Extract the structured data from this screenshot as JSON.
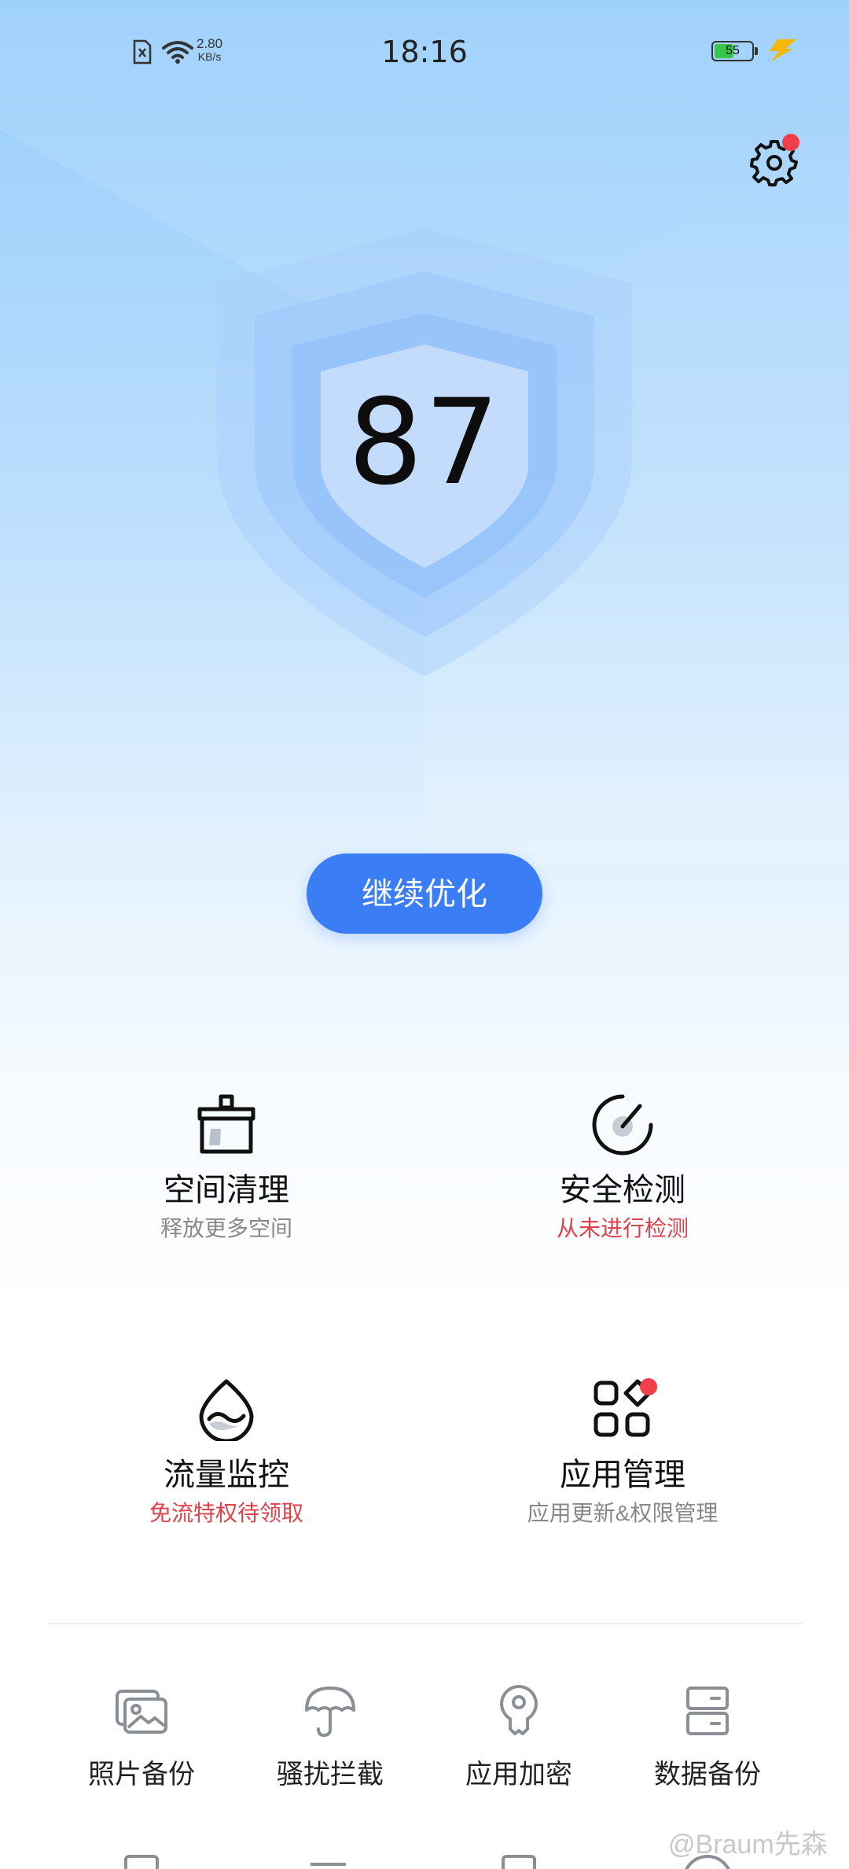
{
  "status_bar": {
    "time": "18:16",
    "net_speed_value": "2.80",
    "net_speed_unit": "KB/s",
    "battery_level": "55",
    "icons": [
      "no-sim-icon",
      "wifi-icon",
      "battery-icon",
      "charging-icon"
    ],
    "battery_fill_color": "#36c64a",
    "charging_color": "#f5b800"
  },
  "header": {
    "settings_icon": "gear-icon",
    "has_notification": true
  },
  "score": {
    "value": "87"
  },
  "primary_action": {
    "label": "继续优化",
    "color": "#3a7df4"
  },
  "features": [
    {
      "title": "空间清理",
      "subtitle": "释放更多空间",
      "icon": "broom-icon",
      "subtitle_alert": false
    },
    {
      "title": "安全检测",
      "subtitle": "从未进行检测",
      "icon": "gauge-icon",
      "subtitle_alert": true
    },
    {
      "title": "流量监控",
      "subtitle": "免流特权待领取",
      "icon": "water-drop-icon",
      "subtitle_alert": true
    },
    {
      "title": "应用管理",
      "subtitle": "应用更新&权限管理",
      "icon": "apps-grid-icon",
      "subtitle_alert": false,
      "has_notification": true
    }
  ],
  "tools": [
    {
      "label": "照片备份",
      "icon": "photos-icon"
    },
    {
      "label": "骚扰拦截",
      "icon": "umbrella-icon"
    },
    {
      "label": "应用加密",
      "icon": "key-icon"
    },
    {
      "label": "数据备份",
      "icon": "storage-icon"
    }
  ],
  "watermark": "@Braum先森",
  "colors": {
    "alert_red": "#e0414b",
    "notification_dot": "#f2404a"
  }
}
